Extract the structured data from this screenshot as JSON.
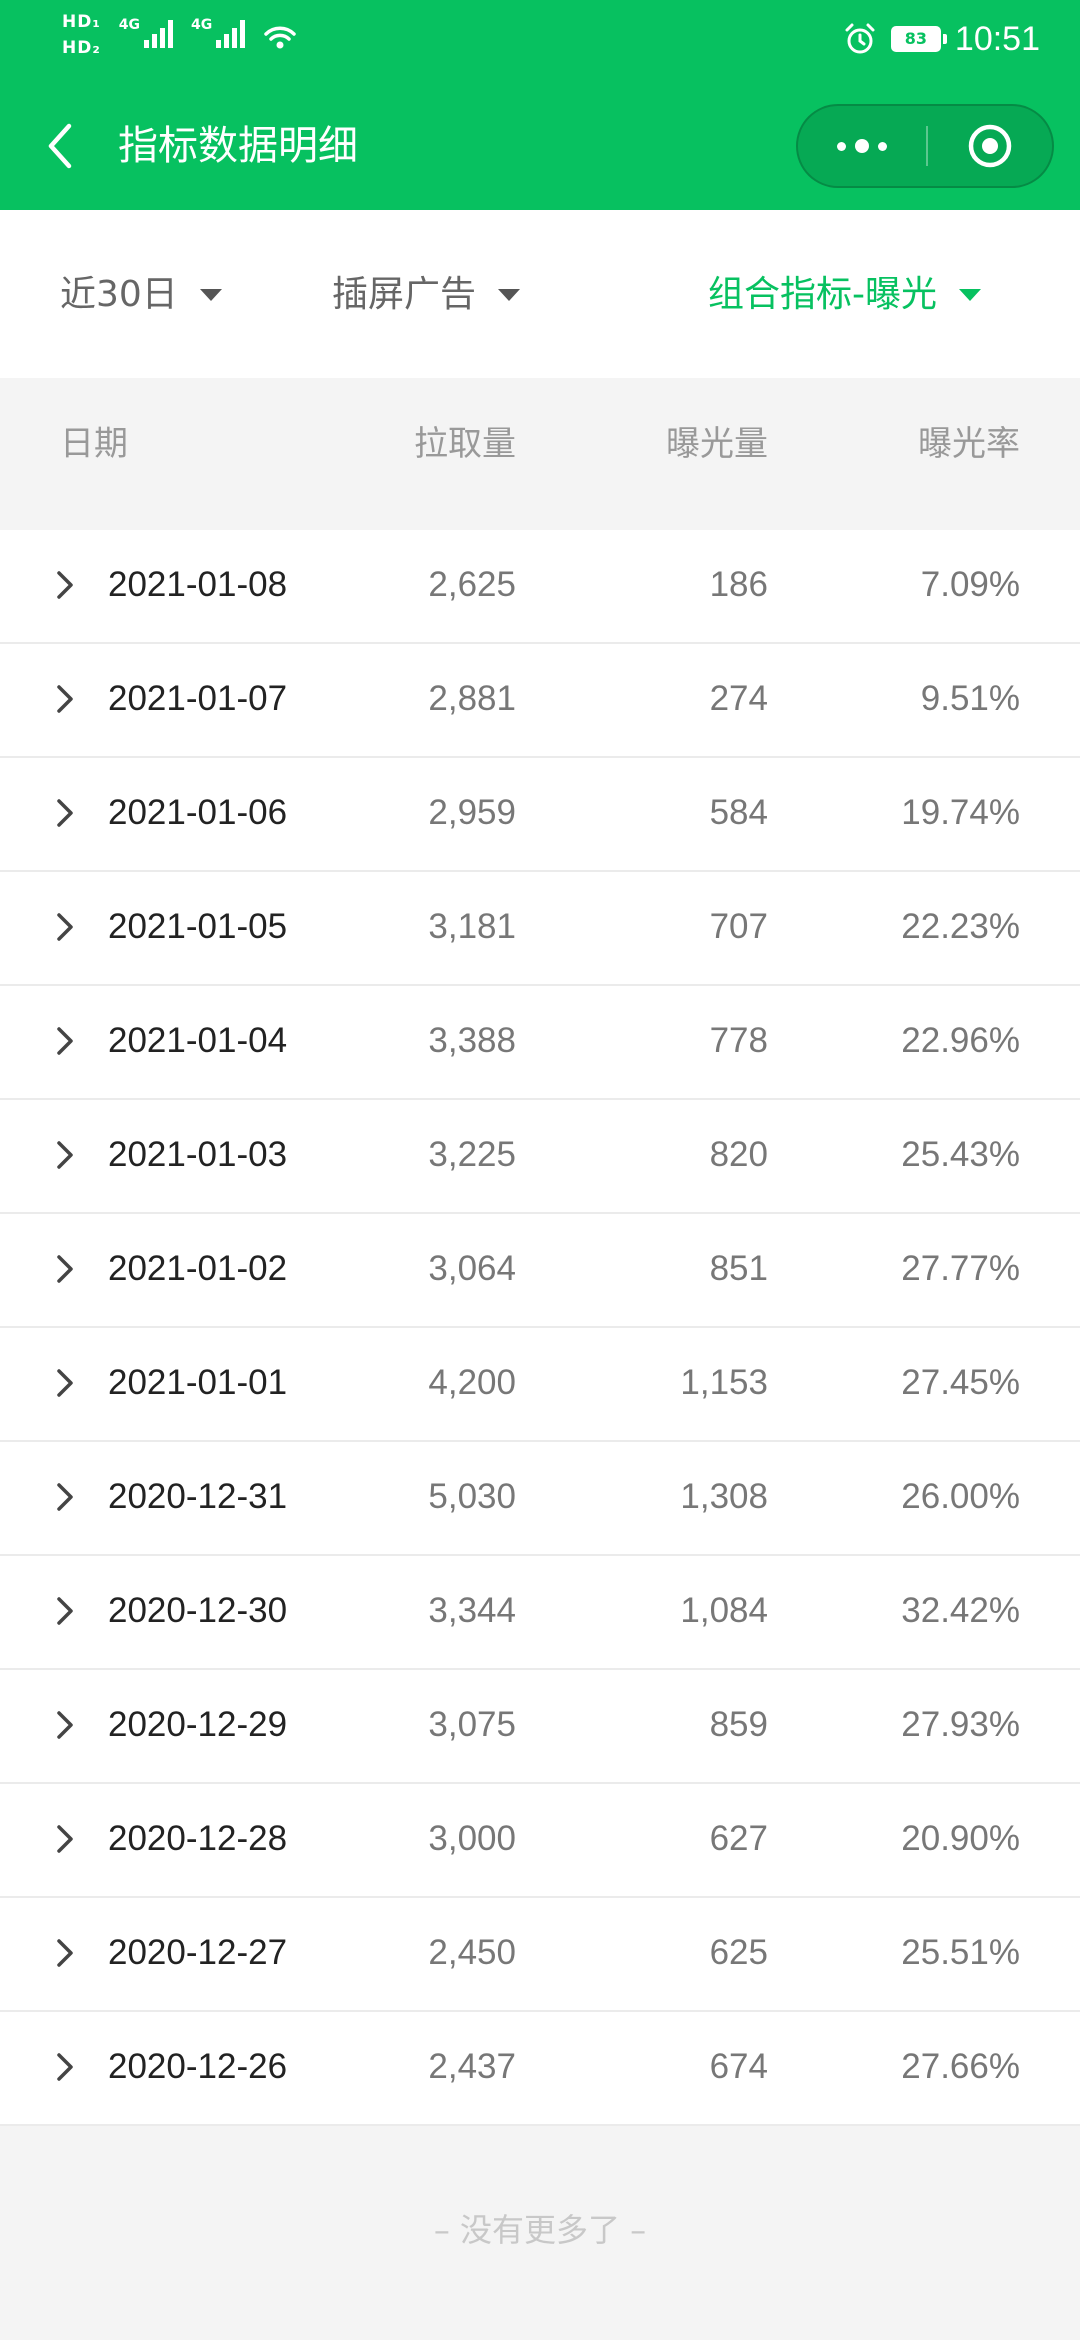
{
  "status_bar": {
    "hd1": "HD₁",
    "hd2": "HD₂",
    "net1": "4G",
    "net2": "4G",
    "battery": "83",
    "time": "10:51",
    "icons": [
      "signal-icon",
      "wifi-icon",
      "alarm-icon",
      "battery-icon"
    ]
  },
  "header": {
    "title": "指标数据明细",
    "back_icon": "back-chevron-icon",
    "more_icon": "more-dots-icon",
    "close_icon": "capsule-close-icon",
    "color": "#07c160"
  },
  "filters": [
    {
      "label": "近30日",
      "active": false
    },
    {
      "label": "插屏广告",
      "active": false
    },
    {
      "label": "组合指标-曝光",
      "active": true
    }
  ],
  "table": {
    "headers": [
      "日期",
      "拉取量",
      "曝光量",
      "曝光率"
    ],
    "rows": [
      {
        "date": "2021-01-08",
        "pull": "2,625",
        "exposure": "186",
        "rate": "7.09%"
      },
      {
        "date": "2021-01-07",
        "pull": "2,881",
        "exposure": "274",
        "rate": "9.51%"
      },
      {
        "date": "2021-01-06",
        "pull": "2,959",
        "exposure": "584",
        "rate": "19.74%"
      },
      {
        "date": "2021-01-05",
        "pull": "3,181",
        "exposure": "707",
        "rate": "22.23%"
      },
      {
        "date": "2021-01-04",
        "pull": "3,388",
        "exposure": "778",
        "rate": "22.96%"
      },
      {
        "date": "2021-01-03",
        "pull": "3,225",
        "exposure": "820",
        "rate": "25.43%"
      },
      {
        "date": "2021-01-02",
        "pull": "3,064",
        "exposure": "851",
        "rate": "27.77%"
      },
      {
        "date": "2021-01-01",
        "pull": "4,200",
        "exposure": "1,153",
        "rate": "27.45%"
      },
      {
        "date": "2020-12-31",
        "pull": "5,030",
        "exposure": "1,308",
        "rate": "26.00%"
      },
      {
        "date": "2020-12-30",
        "pull": "3,344",
        "exposure": "1,084",
        "rate": "32.42%"
      },
      {
        "date": "2020-12-29",
        "pull": "3,075",
        "exposure": "859",
        "rate": "27.93%"
      },
      {
        "date": "2020-12-28",
        "pull": "3,000",
        "exposure": "627",
        "rate": "20.90%"
      },
      {
        "date": "2020-12-27",
        "pull": "2,450",
        "exposure": "625",
        "rate": "25.51%"
      },
      {
        "date": "2020-12-26",
        "pull": "2,437",
        "exposure": "674",
        "rate": "27.66%"
      }
    ]
  },
  "footer": {
    "no_more": "– 没有更多了 –"
  }
}
